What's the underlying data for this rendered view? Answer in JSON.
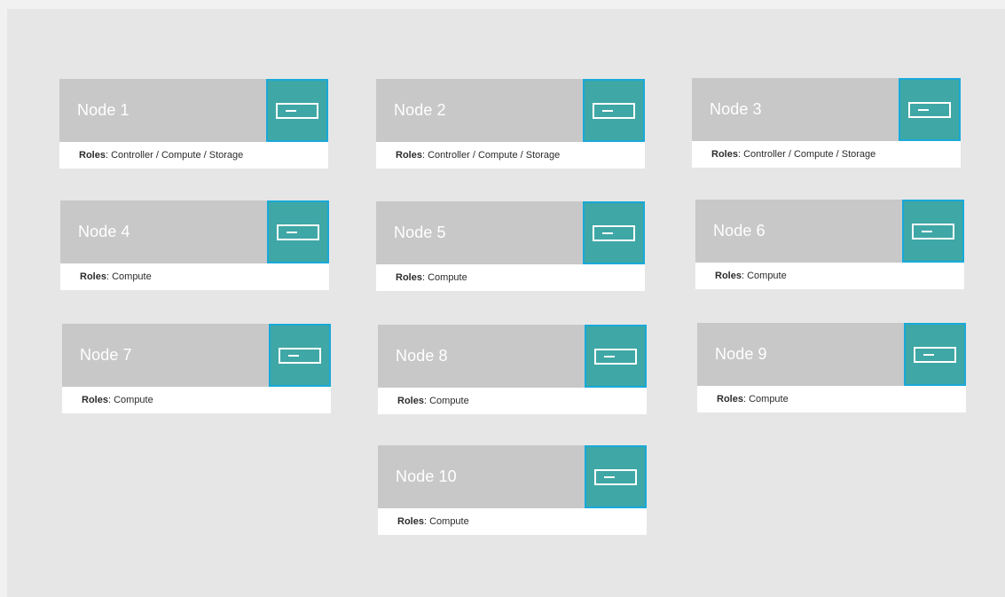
{
  "roles_label": "Roles",
  "roles_separator": ": ",
  "nodes": [
    {
      "name": "Node 1",
      "roles": "Controller / Compute / Storage"
    },
    {
      "name": "Node 2",
      "roles": "Controller / Compute / Storage"
    },
    {
      "name": "Node 3",
      "roles": "Controller / Compute / Storage"
    },
    {
      "name": "Node 4",
      "roles": "Compute"
    },
    {
      "name": "Node 5",
      "roles": "Compute"
    },
    {
      "name": "Node 6",
      "roles": "Compute"
    },
    {
      "name": "Node 7",
      "roles": "Compute"
    },
    {
      "name": "Node 8",
      "roles": "Compute"
    },
    {
      "name": "Node 9",
      "roles": "Compute"
    },
    {
      "name": "Node 10",
      "roles": "Compute"
    }
  ],
  "icons": {
    "node_action": "server-icon"
  },
  "colors": {
    "background": "#e6e6e6",
    "node_header": "#c8c8c8",
    "action_fill": "#3fa7a6",
    "action_border": "#19a9d8"
  }
}
